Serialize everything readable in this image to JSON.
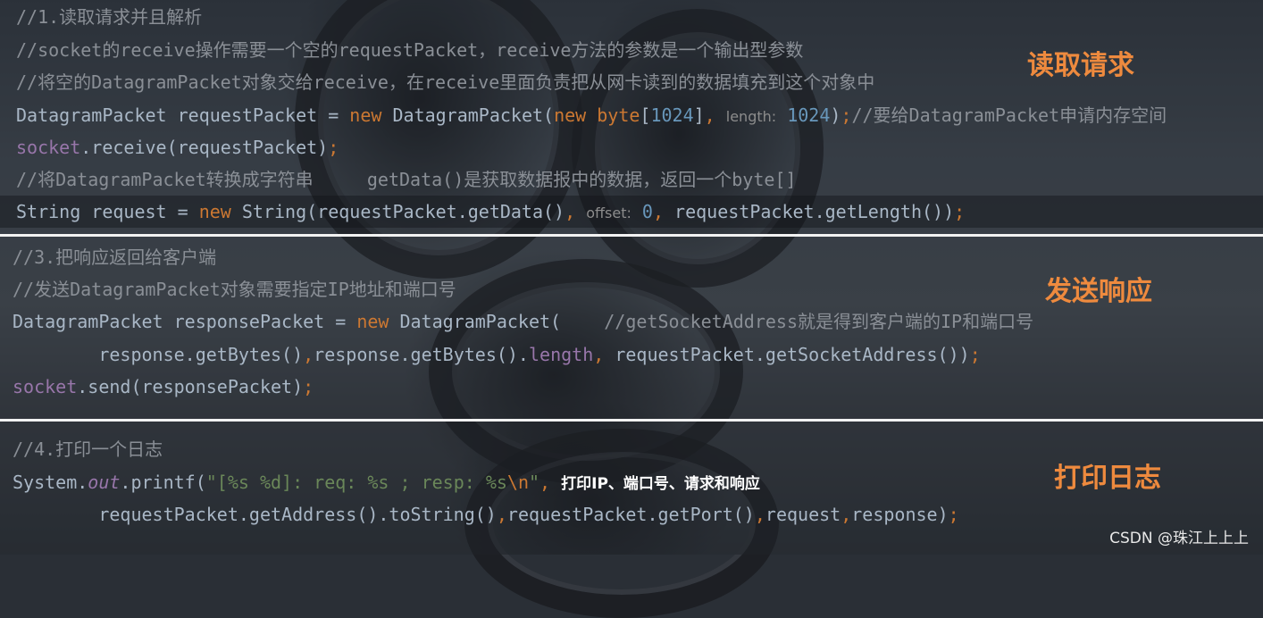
{
  "section_read": {
    "title": "读取请求",
    "l1": "//1.读取请求并且解析",
    "l2": "//socket的receive操作需要一个空的requestPacket，receive方法的参数是一个输出型参数",
    "l3": "//将空的DatagramPacket对象交给receive，在receive里面负责把从网卡读到的数据填充到这个对象中",
    "l4": {
      "a": "DatagramPacket requestPacket = ",
      "new1": "new",
      "b": " DatagramPacket(",
      "new2": "new",
      "sp": " ",
      "byte": "byte",
      "br1": "[",
      "n1": "1024",
      "br2": "]",
      "comma": ", ",
      "hint": "length:",
      "sp2": " ",
      "n2": "1024",
      "close": ")",
      "semi": ";",
      "comment": "//要给DatagramPacket申请内存空间"
    },
    "l5": {
      "socket": "socket",
      "rest": ".receive(requestPacket)",
      "semi": ";"
    },
    "l6": {
      "c1": "//将DatagramPacket转换成字符串",
      "gap": "     ",
      "c2": "getData()是获取数据报中的数据，返回一个byte[]"
    },
    "l7": {
      "a": "String request = ",
      "new": "new",
      "b": " String(requestPacket.getData()",
      "comma1": ", ",
      "hint": "offset:",
      "sp": " ",
      "n": "0",
      "comma2": ", ",
      "c": "requestPacket.getLength())",
      "semi": ";"
    }
  },
  "section_send": {
    "title": "发送响应",
    "l1": "//3.把响应返回给客户端",
    "l2": "//发送DatagramPacket对象需要指定IP地址和端口号",
    "l3": {
      "a": "DatagramPacket responsePacket = ",
      "new": "new",
      "b": " DatagramPacket(",
      "gap": "    ",
      "comment": "//getSocketAddress就是得到客户端的IP和端口号"
    },
    "l4": {
      "indent": "        ",
      "a": "response.getBytes()",
      "comma1": ",",
      "b": "response.getBytes().",
      "length": "length",
      "comma2": ", ",
      "c": "requestPacket.getSocketAddress())",
      "semi": ";"
    },
    "l5": {
      "socket": "socket",
      "rest": ".send(responsePacket)",
      "semi": ";"
    }
  },
  "section_log": {
    "title": "打印日志",
    "l1": "//4.打印一个日志",
    "l2": {
      "a": "System.",
      "out": "out",
      "b": ".printf(",
      "str": "\"[%s %d]: req: %s ; resp: %s",
      "esc": "\\n",
      "q": "\"",
      "comma": ", ",
      "note": "打印IP、端口号、请求和响应"
    },
    "l3": {
      "indent": "        ",
      "a": "requestPacket.getAddress().toString()",
      "c1": ",",
      "b": "requestPacket.getPort()",
      "c2": ",",
      "c": "request",
      "c3": ",",
      "d": "response)",
      "semi": ";"
    }
  },
  "watermark": "CSDN @珠江上上上",
  "colors": {
    "accent_title": "#ee8a3e",
    "keyword": "#cc7832",
    "number": "#6897bb",
    "field": "#9876aa",
    "string": "#6a8759",
    "comment": "#8a8f96",
    "code": "#a9b7c6"
  }
}
